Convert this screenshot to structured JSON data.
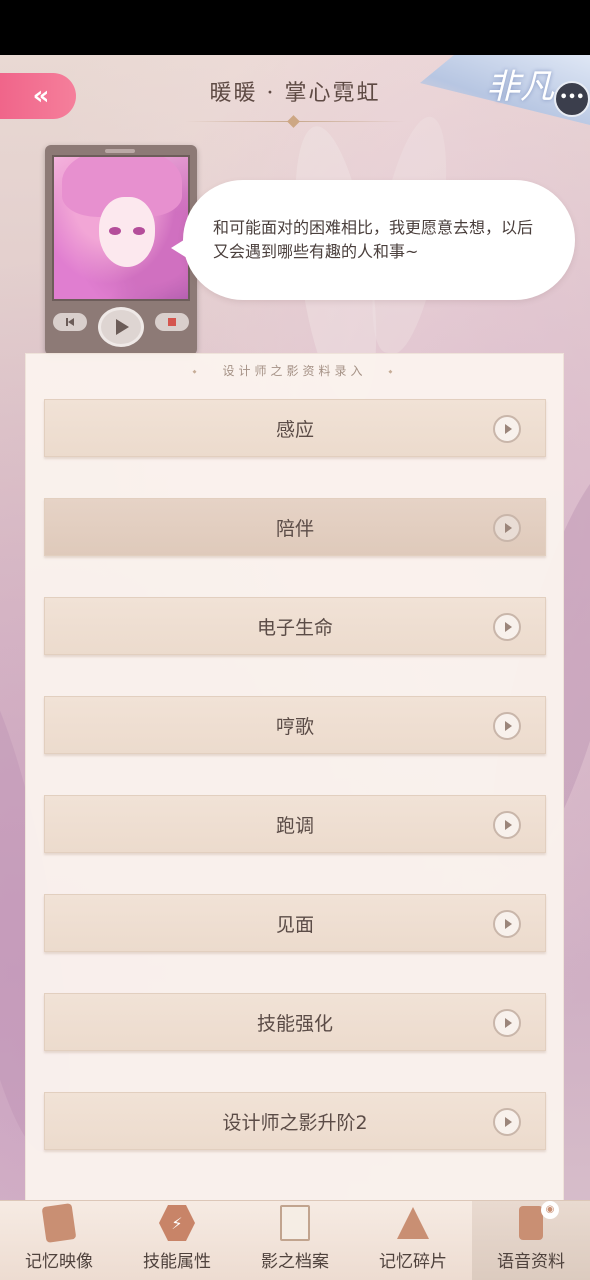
{
  "header": {
    "title": "暖暖 · 掌心霓虹",
    "back_icon": "double-chevron-left-icon",
    "rarity_label": "非凡"
  },
  "player": {
    "quote": "和可能面对的困难相比，我更愿意去想，以后又会遇到哪些有趣的人和事~"
  },
  "panel": {
    "title": "设计师之影资料录入",
    "items": [
      {
        "label": "感应"
      },
      {
        "label": "陪伴"
      },
      {
        "label": "电子生命"
      },
      {
        "label": "哼歌"
      },
      {
        "label": "跑调"
      },
      {
        "label": "见面"
      },
      {
        "label": "技能强化"
      },
      {
        "label": "设计师之影升阶2"
      }
    ]
  },
  "bottom_nav": {
    "items": [
      {
        "label": "记忆映像",
        "icon": "card-icon"
      },
      {
        "label": "技能属性",
        "icon": "lightning-hex-icon"
      },
      {
        "label": "影之档案",
        "icon": "document-icon"
      },
      {
        "label": "记忆碎片",
        "icon": "dress-icon"
      },
      {
        "label": "语音资料",
        "icon": "phone-voice-icon"
      }
    ],
    "active_index": 4
  },
  "colors": {
    "accent_pink": "#f0658a",
    "text_brown": "#5b4c47",
    "panel_bg": "#fbf3ee"
  }
}
